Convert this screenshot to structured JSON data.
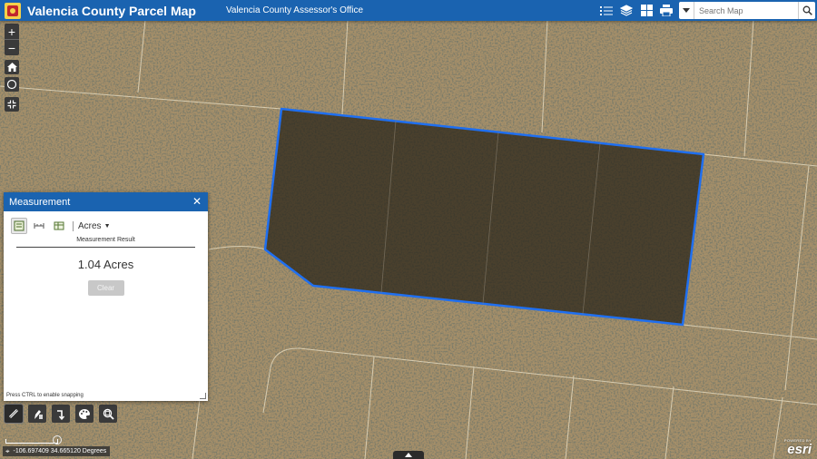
{
  "header": {
    "app_title": "Valencia County Parcel Map",
    "subtitle": "Valencia County Assessor's Office",
    "tool_icons": [
      "list-icon",
      "layers-icon",
      "basemap-grid-icon",
      "print-icon"
    ],
    "search_placeholder": "Search Map"
  },
  "map_controls": {
    "zoom_in": "+",
    "zoom_out": "−",
    "buttons": [
      "home-icon",
      "locate-icon",
      "fullscreen-icon"
    ]
  },
  "measurement": {
    "title": "Measurement",
    "close": "✕",
    "tools": [
      "area-icon",
      "distance-icon",
      "location-icon"
    ],
    "active_tool": "area-icon",
    "unit": "Acres",
    "result_label": "Measurement Result",
    "result_value": "1.04 Acres",
    "clear_label": "Clear",
    "snap_hint": "Press CTRL to enable snapping"
  },
  "widgets": [
    "measure-icon",
    "draw-icon",
    "directions-icon",
    "paint-icon",
    "search-zoom-icon"
  ],
  "coordinates": "-106.697409 34.665120 Degrees",
  "attribution": {
    "powered_by": "POWERED BY",
    "brand": "esri"
  },
  "colors": {
    "header_blue": "#1a63b0",
    "parcel_outline": "#1f6ff0",
    "parcel_fill": "#2a2418",
    "panel_white": "#ffffff"
  }
}
